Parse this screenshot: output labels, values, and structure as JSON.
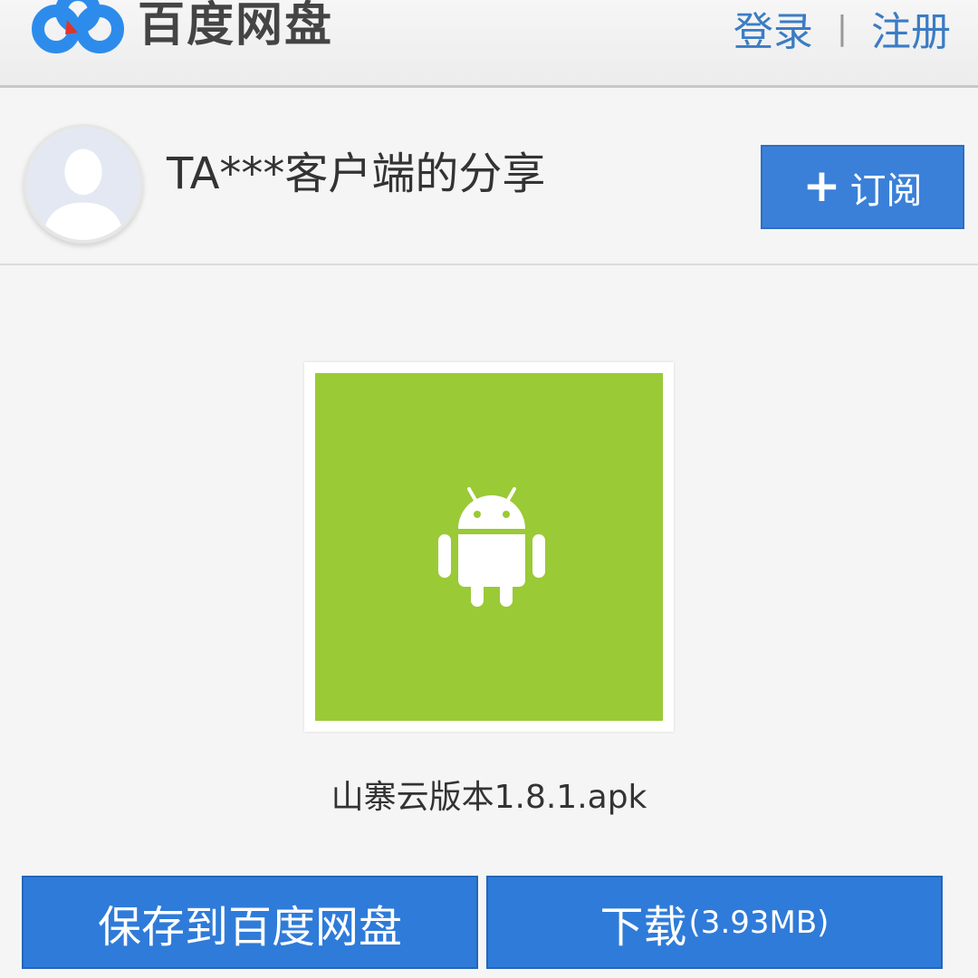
{
  "header": {
    "logo_text": "百度网盘",
    "login_label": "登录",
    "separator": "|",
    "register_label": "注册"
  },
  "sharer": {
    "title": "TA***客户端的分享",
    "subscribe_plus": "+",
    "subscribe_label": "订阅"
  },
  "file": {
    "name": "山寨云版本1.8.1.apk",
    "icon": "android-icon",
    "thumb_color": "#9aca36"
  },
  "actions": {
    "save_label": "保存到百度网盘",
    "download_label": "下载",
    "download_size": "(3.93MB)"
  },
  "colors": {
    "accent": "#2f7bd9",
    "link": "#3b7cc4"
  }
}
